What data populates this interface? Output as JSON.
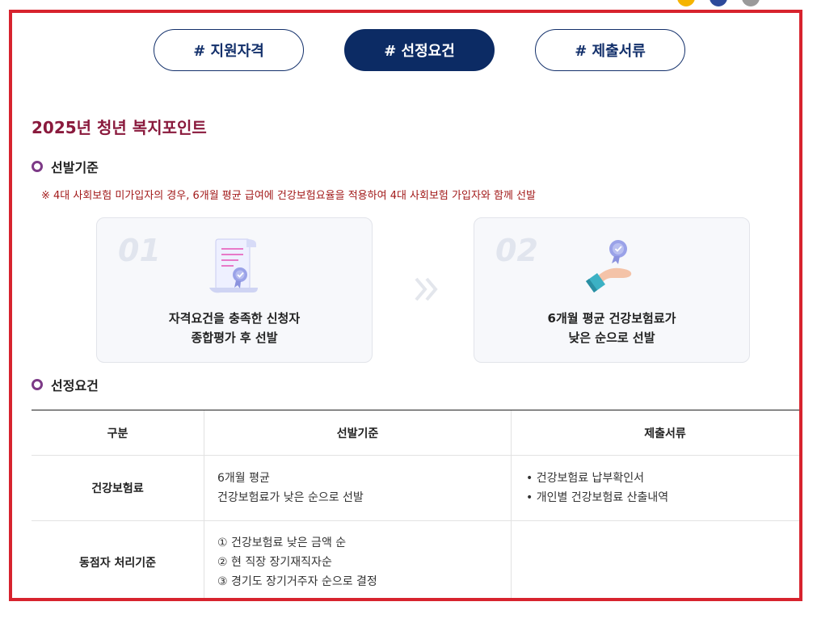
{
  "tabs": [
    {
      "label": "# 지원자격"
    },
    {
      "label": "# 선정요건"
    },
    {
      "label": "# 제출서류"
    }
  ],
  "active_tab_index": 1,
  "page_title": "2025년 청년 복지포인트",
  "selection_section": {
    "title": "선발기준",
    "note": "※ 4대 사회보험 미가입자의 경우, 6개월 평균 급여에 건강보험요율을 적용하여 4대 사회보험 가입자와 함께 선발",
    "cards": [
      {
        "number": "01",
        "icon": "certificate-document-icon",
        "lines": [
          "자격요건을 충족한 신청자",
          "종합평가 후 선발"
        ]
      },
      {
        "number": "02",
        "icon": "hand-holding-badge-icon",
        "lines": [
          "6개월 평균 건강보험료가",
          "낮은 순으로 선발"
        ]
      }
    ],
    "arrow_icon": "double-chevron-right-icon"
  },
  "requirements_section": {
    "title": "선정요건",
    "table": {
      "headers": [
        "구분",
        "선발기준",
        "제출서류"
      ],
      "rows": [
        {
          "category": "건강보험료",
          "criteria": [
            "6개월 평균",
            "건강보험료가 낮은 순으로 선발"
          ],
          "documents": [
            "• 건강보험료 납부확인서",
            "• 개인별 건강보험료 산출내역"
          ]
        },
        {
          "category": "동점자 처리기준",
          "criteria": [
            "① 건강보험료 낮은 금액 순",
            "② 현 직장 장기재직자순",
            "③ 경기도 장기거주자 순으로 결정"
          ],
          "documents": []
        }
      ]
    }
  },
  "colors": {
    "frame_border": "#d7232e",
    "active_tab_bg": "#0c2b64",
    "tab_border": "#13306b",
    "title_color": "#8a1a3d",
    "note_color": "#a21a1a",
    "bullet_color": "#7d3a87"
  }
}
